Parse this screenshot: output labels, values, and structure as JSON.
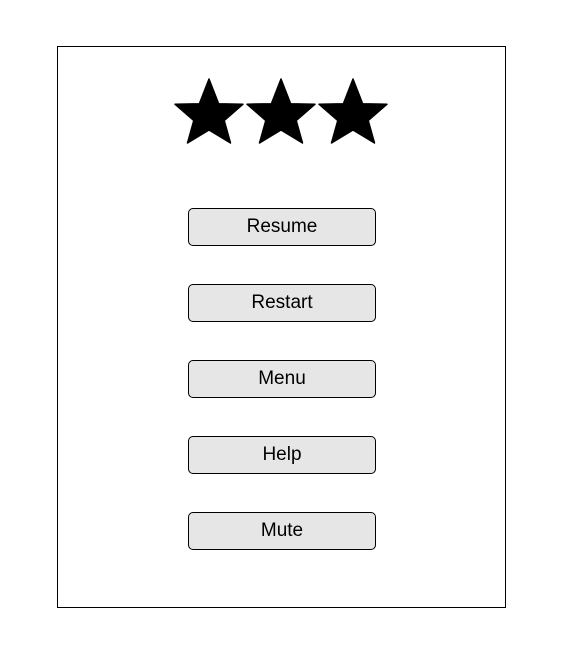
{
  "pause_menu": {
    "rating": {
      "stars_filled": 3,
      "stars_total": 3,
      "icon": "star-icon",
      "color": "#000000"
    },
    "buttons": {
      "resume": "Resume",
      "restart": "Restart",
      "menu": "Menu",
      "help": "Help",
      "mute": "Mute"
    },
    "colors": {
      "button_fill": "#e6e6e6",
      "border": "#000000",
      "background": "#ffffff"
    }
  }
}
